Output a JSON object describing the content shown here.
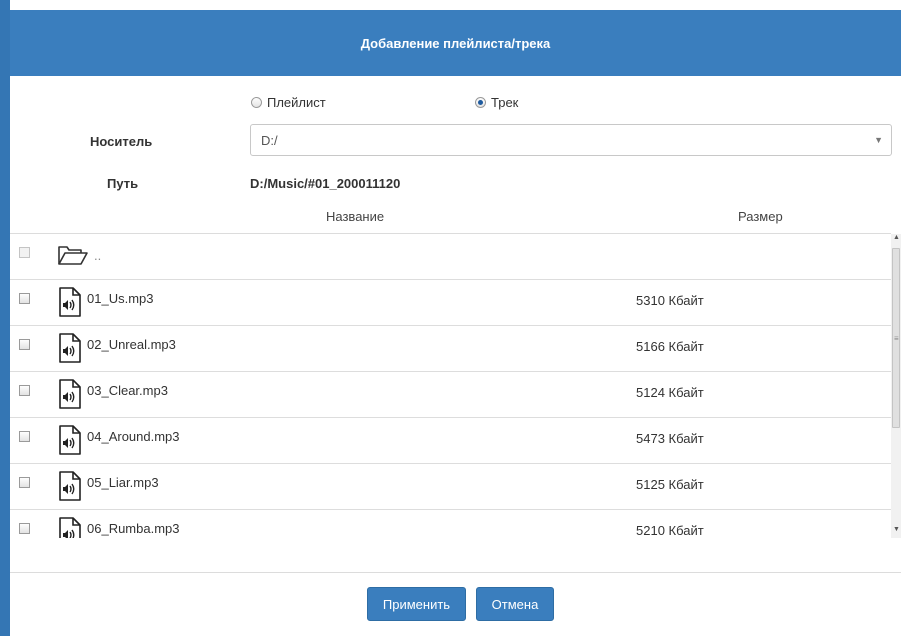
{
  "dialog": {
    "title": "Добавление плейлиста/трека",
    "type_options": [
      {
        "label": "Плейлист",
        "selected": false
      },
      {
        "label": "Трек",
        "selected": true
      }
    ],
    "media_label": "Носитель",
    "media_value": "D:/",
    "path_label": "Путь",
    "path_value": "D:/Music/#01_200011120",
    "columns": {
      "name": "Название",
      "size": "Размер"
    },
    "parent_dir": "..",
    "files": [
      {
        "name": "01_Us.mp3",
        "size": "5310 Кбайт"
      },
      {
        "name": "02_Unreal.mp3",
        "size": "5166 Кбайт"
      },
      {
        "name": "03_Clear.mp3",
        "size": "5124 Кбайт"
      },
      {
        "name": "04_Around.mp3",
        "size": "5473 Кбайт"
      },
      {
        "name": "05_Liar.mp3",
        "size": "5125 Кбайт"
      },
      {
        "name": "06_Rumba.mp3",
        "size": "5210 Кбайт"
      }
    ],
    "apply_label": "Применить",
    "cancel_label": "Отмена"
  },
  "colors": {
    "header": "#3a7ebe",
    "button": "#3a7ebe",
    "accent_edge": "#3476b4"
  },
  "icons": {
    "parent": "folder-open-icon",
    "file": "audio-file-icon"
  }
}
